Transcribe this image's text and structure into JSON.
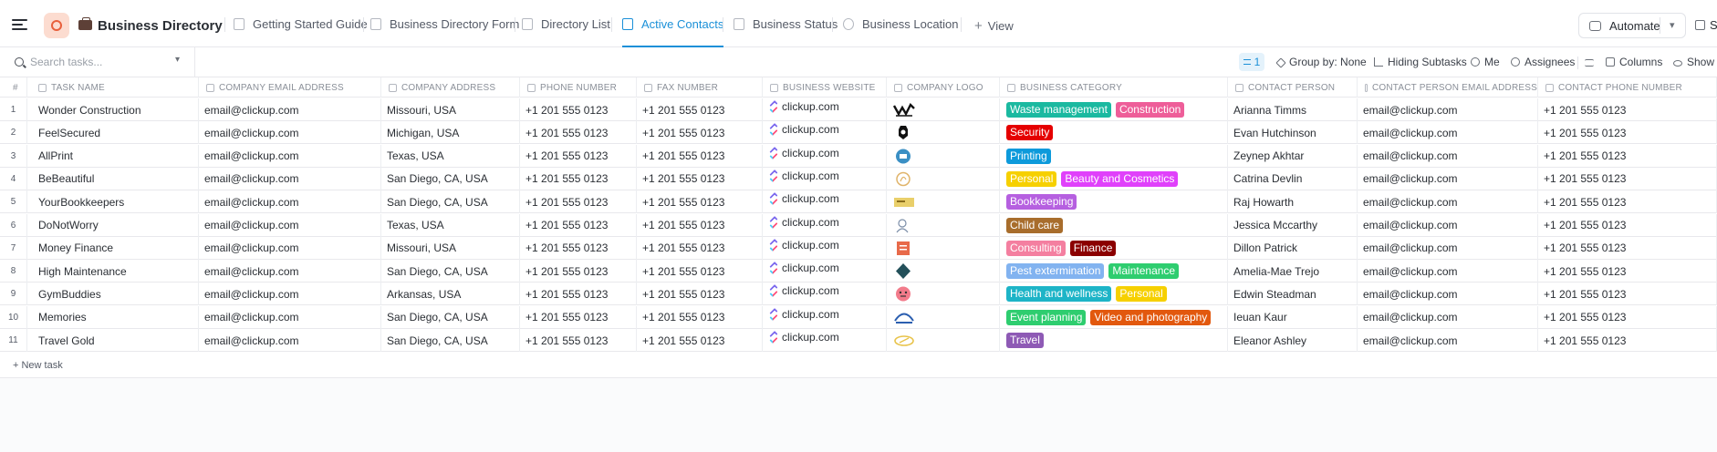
{
  "header": {
    "title": "Business Directory",
    "tabs": [
      {
        "label": "Getting Started Guide",
        "active": false
      },
      {
        "label": "Business Directory Form",
        "active": false
      },
      {
        "label": "Directory List",
        "active": false
      },
      {
        "label": "Active Contacts",
        "active": true
      },
      {
        "label": "Business Status",
        "active": false
      },
      {
        "label": "Business Location",
        "active": false
      }
    ],
    "view_label": "View",
    "view_plus": "+",
    "automate_label": "Automate",
    "automate_chevron": "▾",
    "share_label": "Share",
    "accent_color": "#1b90d8"
  },
  "toolbar": {
    "search_placeholder": "Search tasks...",
    "search_chevron": "▾",
    "filter_count": "1",
    "group_by": "Group by: None",
    "hiding_subtasks": "Hiding Subtasks",
    "me": "Me",
    "assignees": "Assignees",
    "columns": "Columns",
    "show": "Show"
  },
  "table": {
    "columns": [
      {
        "label": "#"
      },
      {
        "label": "TASK NAME"
      },
      {
        "label": "COMPANY EMAIL ADDRESS"
      },
      {
        "label": "COMPANY ADDRESS"
      },
      {
        "label": "PHONE NUMBER"
      },
      {
        "label": "FAX NUMBER"
      },
      {
        "label": "BUSINESS WEBSITE"
      },
      {
        "label": "COMPANY LOGO"
      },
      {
        "label": "BUSINESS CATEGORY"
      },
      {
        "label": "CONTACT PERSON"
      },
      {
        "label": "CONTACT PERSON EMAIL ADDRESS"
      },
      {
        "label": "CONTACT PHONE NUMBER"
      }
    ],
    "rows": [
      {
        "num": "1",
        "name": "Wonder Construction",
        "email": "email@clickup.com",
        "address": "Missouri, USA",
        "phone": "+1 201 555 0123",
        "fax": "+1 201 555 0123",
        "website": "clickup.com",
        "logo": "wonder-construction-logo",
        "categories": [
          {
            "label": "Waste management",
            "color": "#1bb9a0"
          },
          {
            "label": "Construction",
            "color": "#ee5e99"
          }
        ],
        "contact": "Arianna Timms",
        "contact_email": "email@clickup.com",
        "contact_phone": "+1 201 555 0123"
      },
      {
        "num": "2",
        "name": "FeelSecured",
        "email": "email@clickup.com",
        "address": "Michigan, USA",
        "phone": "+1 201 555 0123",
        "fax": "+1 201 555 0123",
        "website": "clickup.com",
        "logo": "feelsecured-logo",
        "categories": [
          {
            "label": "Security",
            "color": "#e50000"
          }
        ],
        "contact": "Evan Hutchinson",
        "contact_email": "email@clickup.com",
        "contact_phone": "+1 201 555 0123"
      },
      {
        "num": "3",
        "name": "AllPrint",
        "email": "email@clickup.com",
        "address": "Texas, USA",
        "phone": "+1 201 555 0123",
        "fax": "+1 201 555 0123",
        "website": "clickup.com",
        "logo": "allprint-logo",
        "categories": [
          {
            "label": "Printing",
            "color": "#0d9adb"
          }
        ],
        "contact": "Zeynep Akhtar",
        "contact_email": "email@clickup.com",
        "contact_phone": "+1 201 555 0123"
      },
      {
        "num": "4",
        "name": "BeBeautiful",
        "email": "email@clickup.com",
        "address": "San Diego, CA, USA",
        "phone": "+1 201 555 0123",
        "fax": "+1 201 555 0123",
        "website": "clickup.com",
        "logo": "bebeautiful-logo",
        "categories": [
          {
            "label": "Personal",
            "color": "#f6d000"
          },
          {
            "label": "Beauty and Cosmetics",
            "color": "#e040fb"
          }
        ],
        "contact": "Catrina Devlin",
        "contact_email": "email@clickup.com",
        "contact_phone": "+1 201 555 0123"
      },
      {
        "num": "5",
        "name": "YourBookkeepers",
        "email": "email@clickup.com",
        "address": "San Diego, CA, USA",
        "phone": "+1 201 555 0123",
        "fax": "+1 201 555 0123",
        "website": "clickup.com",
        "logo": "yourbookkeepers-logo",
        "categories": [
          {
            "label": "Bookkeeping",
            "color": "#b660e0"
          }
        ],
        "contact": "Raj Howarth",
        "contact_email": "email@clickup.com",
        "contact_phone": "+1 201 555 0123"
      },
      {
        "num": "6",
        "name": "DoNotWorry",
        "email": "email@clickup.com",
        "address": "Texas, USA",
        "phone": "+1 201 555 0123",
        "fax": "+1 201 555 0123",
        "website": "clickup.com",
        "logo": "donotworry-logo",
        "categories": [
          {
            "label": "Child care",
            "color": "#a86d2c"
          }
        ],
        "contact": "Jessica Mccarthy",
        "contact_email": "email@clickup.com",
        "contact_phone": "+1 201 555 0123"
      },
      {
        "num": "7",
        "name": "Money Finance",
        "email": "email@clickup.com",
        "address": "Missouri, USA",
        "phone": "+1 201 555 0123",
        "fax": "+1 201 555 0123",
        "website": "clickup.com",
        "logo": "money-finance-logo",
        "categories": [
          {
            "label": "Consulting",
            "color": "#f47fa0"
          },
          {
            "label": "Finance",
            "color": "#8b0000"
          }
        ],
        "contact": "Dillon Patrick",
        "contact_email": "email@clickup.com",
        "contact_phone": "+1 201 555 0123"
      },
      {
        "num": "8",
        "name": "High Maintenance",
        "email": "email@clickup.com",
        "address": "San Diego, CA, USA",
        "phone": "+1 201 555 0123",
        "fax": "+1 201 555 0123",
        "website": "clickup.com",
        "logo": "high-maintenance-logo",
        "categories": [
          {
            "label": "Pest extermination",
            "color": "#82b3f0"
          },
          {
            "label": "Maintenance",
            "color": "#2ecd6f"
          }
        ],
        "contact": "Amelia-Mae Trejo",
        "contact_email": "email@clickup.com",
        "contact_phone": "+1 201 555 0123"
      },
      {
        "num": "9",
        "name": "GymBuddies",
        "email": "email@clickup.com",
        "address": "Arkansas, USA",
        "phone": "+1 201 555 0123",
        "fax": "+1 201 555 0123",
        "website": "clickup.com",
        "logo": "gymbuddies-logo",
        "categories": [
          {
            "label": "Health and wellness",
            "color": "#1db4c7"
          },
          {
            "label": "Personal",
            "color": "#f6d000"
          }
        ],
        "contact": "Edwin Steadman",
        "contact_email": "email@clickup.com",
        "contact_phone": "+1 201 555 0123"
      },
      {
        "num": "10",
        "name": "Memories",
        "email": "email@clickup.com",
        "address": "San Diego, CA, USA",
        "phone": "+1 201 555 0123",
        "fax": "+1 201 555 0123",
        "website": "clickup.com",
        "logo": "memories-logo",
        "categories": [
          {
            "label": "Event planning",
            "color": "#2ecd6f"
          },
          {
            "label": "Video and photography",
            "color": "#e2580e"
          }
        ],
        "contact": "Ieuan Kaur",
        "contact_email": "email@clickup.com",
        "contact_phone": "+1 201 555 0123"
      },
      {
        "num": "11",
        "name": "Travel Gold",
        "email": "email@clickup.com",
        "address": "San Diego, CA, USA",
        "phone": "+1 201 555 0123",
        "fax": "+1 201 555 0123",
        "website": "clickup.com",
        "logo": "travel-gold-logo",
        "categories": [
          {
            "label": "Travel",
            "color": "#8e5ab5"
          }
        ],
        "contact": "Eleanor Ashley",
        "contact_email": "email@clickup.com",
        "contact_phone": "+1 201 555 0123"
      }
    ],
    "new_task_label": "+ New task"
  }
}
